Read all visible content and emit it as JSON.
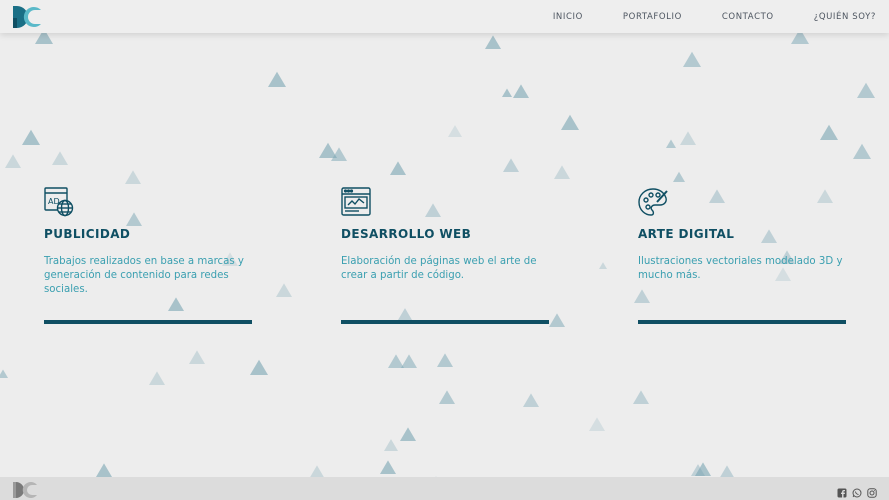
{
  "brand": {
    "logo_icon": "dc-logo-icon"
  },
  "nav": {
    "items": [
      {
        "label": "INICIO"
      },
      {
        "label": "PORTAFOLIO"
      },
      {
        "label": "CONTACTO"
      },
      {
        "label": "¿QUIÉN SOY?"
      }
    ]
  },
  "services": [
    {
      "icon": "ad-globe-icon",
      "title": "PUBLICIDAD",
      "description": "Trabajos realizados en base a marcas y generación de contenido para redes sociales."
    },
    {
      "icon": "browser-code-icon",
      "title": "DESARROLLO WEB",
      "description": "Elaboración de páginas web el arte de crear a partir de código."
    },
    {
      "icon": "palette-brush-icon",
      "title": "ARTE DIGITAL",
      "description": "Ilustraciones vectoriales modelado 3D y mucho más."
    }
  ],
  "footer": {
    "logo_icon": "dc-logo-gray-icon",
    "social": [
      "facebook-icon",
      "whatsapp-icon",
      "instagram-icon"
    ]
  },
  "colors": {
    "accent_dark": "#0f4f63",
    "accent_text": "#3a9fb0",
    "triangle_color": "#7aa5b3",
    "background": "#ededed"
  }
}
